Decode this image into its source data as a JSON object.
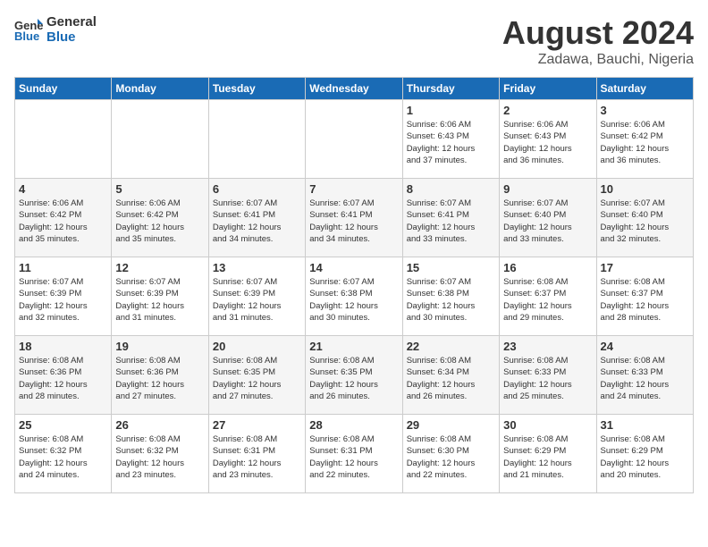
{
  "header": {
    "logo_line1": "General",
    "logo_line2": "Blue",
    "month_year": "August 2024",
    "location": "Zadawa, Bauchi, Nigeria"
  },
  "days_of_week": [
    "Sunday",
    "Monday",
    "Tuesday",
    "Wednesday",
    "Thursday",
    "Friday",
    "Saturday"
  ],
  "weeks": [
    [
      {
        "day": "",
        "content": ""
      },
      {
        "day": "",
        "content": ""
      },
      {
        "day": "",
        "content": ""
      },
      {
        "day": "",
        "content": ""
      },
      {
        "day": "1",
        "content": "Sunrise: 6:06 AM\nSunset: 6:43 PM\nDaylight: 12 hours\nand 37 minutes."
      },
      {
        "day": "2",
        "content": "Sunrise: 6:06 AM\nSunset: 6:43 PM\nDaylight: 12 hours\nand 36 minutes."
      },
      {
        "day": "3",
        "content": "Sunrise: 6:06 AM\nSunset: 6:42 PM\nDaylight: 12 hours\nand 36 minutes."
      }
    ],
    [
      {
        "day": "4",
        "content": "Sunrise: 6:06 AM\nSunset: 6:42 PM\nDaylight: 12 hours\nand 35 minutes."
      },
      {
        "day": "5",
        "content": "Sunrise: 6:06 AM\nSunset: 6:42 PM\nDaylight: 12 hours\nand 35 minutes."
      },
      {
        "day": "6",
        "content": "Sunrise: 6:07 AM\nSunset: 6:41 PM\nDaylight: 12 hours\nand 34 minutes."
      },
      {
        "day": "7",
        "content": "Sunrise: 6:07 AM\nSunset: 6:41 PM\nDaylight: 12 hours\nand 34 minutes."
      },
      {
        "day": "8",
        "content": "Sunrise: 6:07 AM\nSunset: 6:41 PM\nDaylight: 12 hours\nand 33 minutes."
      },
      {
        "day": "9",
        "content": "Sunrise: 6:07 AM\nSunset: 6:40 PM\nDaylight: 12 hours\nand 33 minutes."
      },
      {
        "day": "10",
        "content": "Sunrise: 6:07 AM\nSunset: 6:40 PM\nDaylight: 12 hours\nand 32 minutes."
      }
    ],
    [
      {
        "day": "11",
        "content": "Sunrise: 6:07 AM\nSunset: 6:39 PM\nDaylight: 12 hours\nand 32 minutes."
      },
      {
        "day": "12",
        "content": "Sunrise: 6:07 AM\nSunset: 6:39 PM\nDaylight: 12 hours\nand 31 minutes."
      },
      {
        "day": "13",
        "content": "Sunrise: 6:07 AM\nSunset: 6:39 PM\nDaylight: 12 hours\nand 31 minutes."
      },
      {
        "day": "14",
        "content": "Sunrise: 6:07 AM\nSunset: 6:38 PM\nDaylight: 12 hours\nand 30 minutes."
      },
      {
        "day": "15",
        "content": "Sunrise: 6:07 AM\nSunset: 6:38 PM\nDaylight: 12 hours\nand 30 minutes."
      },
      {
        "day": "16",
        "content": "Sunrise: 6:08 AM\nSunset: 6:37 PM\nDaylight: 12 hours\nand 29 minutes."
      },
      {
        "day": "17",
        "content": "Sunrise: 6:08 AM\nSunset: 6:37 PM\nDaylight: 12 hours\nand 28 minutes."
      }
    ],
    [
      {
        "day": "18",
        "content": "Sunrise: 6:08 AM\nSunset: 6:36 PM\nDaylight: 12 hours\nand 28 minutes."
      },
      {
        "day": "19",
        "content": "Sunrise: 6:08 AM\nSunset: 6:36 PM\nDaylight: 12 hours\nand 27 minutes."
      },
      {
        "day": "20",
        "content": "Sunrise: 6:08 AM\nSunset: 6:35 PM\nDaylight: 12 hours\nand 27 minutes."
      },
      {
        "day": "21",
        "content": "Sunrise: 6:08 AM\nSunset: 6:35 PM\nDaylight: 12 hours\nand 26 minutes."
      },
      {
        "day": "22",
        "content": "Sunrise: 6:08 AM\nSunset: 6:34 PM\nDaylight: 12 hours\nand 26 minutes."
      },
      {
        "day": "23",
        "content": "Sunrise: 6:08 AM\nSunset: 6:33 PM\nDaylight: 12 hours\nand 25 minutes."
      },
      {
        "day": "24",
        "content": "Sunrise: 6:08 AM\nSunset: 6:33 PM\nDaylight: 12 hours\nand 24 minutes."
      }
    ],
    [
      {
        "day": "25",
        "content": "Sunrise: 6:08 AM\nSunset: 6:32 PM\nDaylight: 12 hours\nand 24 minutes."
      },
      {
        "day": "26",
        "content": "Sunrise: 6:08 AM\nSunset: 6:32 PM\nDaylight: 12 hours\nand 23 minutes."
      },
      {
        "day": "27",
        "content": "Sunrise: 6:08 AM\nSunset: 6:31 PM\nDaylight: 12 hours\nand 23 minutes."
      },
      {
        "day": "28",
        "content": "Sunrise: 6:08 AM\nSunset: 6:31 PM\nDaylight: 12 hours\nand 22 minutes."
      },
      {
        "day": "29",
        "content": "Sunrise: 6:08 AM\nSunset: 6:30 PM\nDaylight: 12 hours\nand 22 minutes."
      },
      {
        "day": "30",
        "content": "Sunrise: 6:08 AM\nSunset: 6:29 PM\nDaylight: 12 hours\nand 21 minutes."
      },
      {
        "day": "31",
        "content": "Sunrise: 6:08 AM\nSunset: 6:29 PM\nDaylight: 12 hours\nand 20 minutes."
      }
    ]
  ]
}
